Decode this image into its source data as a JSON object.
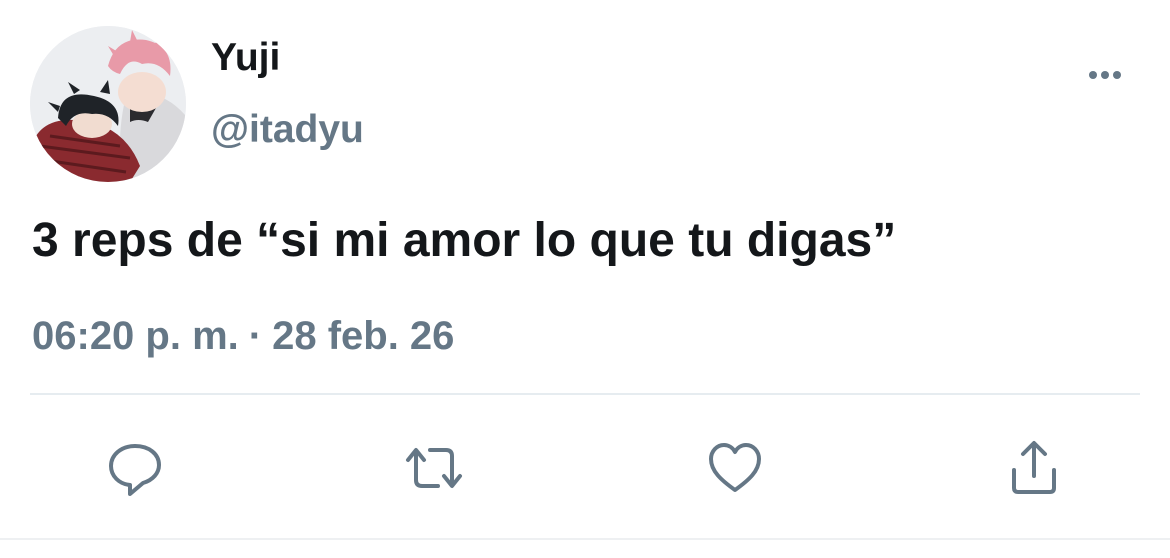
{
  "tweet": {
    "author": {
      "display_name": "Yuji",
      "handle": "@itadyu",
      "avatar": "profile-avatar-illustration"
    },
    "text": "3 reps de “si mi amor lo que tu digas”",
    "time": "06:20 p. m.",
    "separator": "·",
    "date": "28 feb. 26",
    "more_icon": "more-horizontal-icon",
    "actions": [
      {
        "icon": "reply-icon"
      },
      {
        "icon": "retweet-icon"
      },
      {
        "icon": "like-icon"
      },
      {
        "icon": "share-icon"
      }
    ]
  },
  "colors": {
    "text_primary": "#14171a",
    "text_secondary": "#657786",
    "divider": "#e6ecf0"
  }
}
